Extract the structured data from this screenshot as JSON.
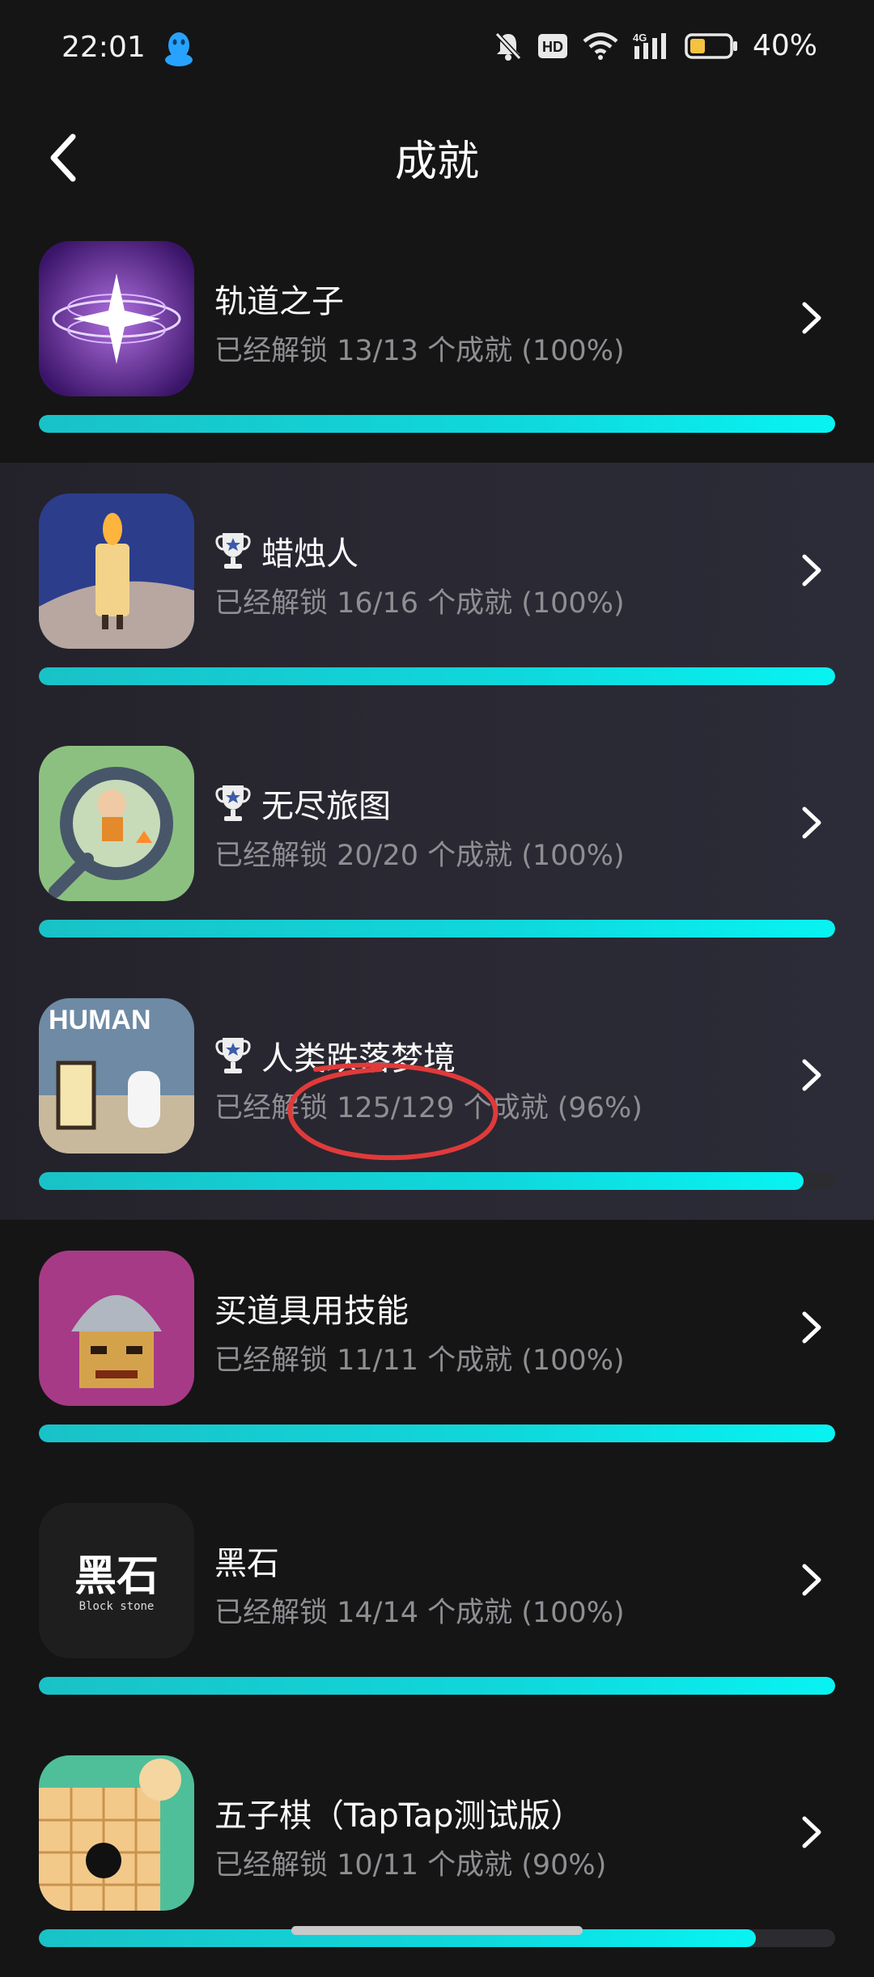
{
  "status_bar": {
    "time": "22:01",
    "battery_percent": "40%",
    "network_label": "4G",
    "hd_label": "HD",
    "battery_level": 0.4,
    "icons": [
      "qq-icon",
      "mute-bell-icon",
      "hd-icon",
      "wifi-icon",
      "signal-icon",
      "battery-icon"
    ]
  },
  "header": {
    "title": "成就",
    "back_icon": "back-chevron-icon"
  },
  "colors": {
    "background": "#151515",
    "highlight_row": "#2a2832",
    "progress_fill": "#0fd8dc",
    "progress_track": "#2c2c30",
    "secondary_text": "#8e8e93",
    "annotation": "#e03a3a"
  },
  "items": [
    {
      "title": "轨道之子",
      "progress": "已经解锁 13/13 个成就 (100%)",
      "fraction": 1.0,
      "trophy": false,
      "highlight": false,
      "icon": "orbit-game-icon"
    },
    {
      "title": "蜡烛人",
      "progress": "已经解锁 16/16 个成就 (100%)",
      "fraction": 1.0,
      "trophy": true,
      "highlight": true,
      "icon": "candleman-game-icon"
    },
    {
      "title": "无尽旅图",
      "progress": "已经解锁 20/20 个成就 (100%)",
      "fraction": 1.0,
      "trophy": true,
      "highlight": true,
      "icon": "endless-journey-game-icon"
    },
    {
      "title": "人类跌落梦境",
      "progress": "已经解锁 125/129 个成就 (96%)",
      "fraction": 0.96,
      "trophy": true,
      "highlight": true,
      "icon": "human-fall-flat-game-icon"
    },
    {
      "title": "买道具用技能",
      "progress": "已经解锁 11/11 个成就 (100%)",
      "fraction": 1.0,
      "trophy": false,
      "highlight": false,
      "icon": "knight-game-icon"
    },
    {
      "title": "黑石",
      "progress": "已经解锁 14/14 个成就 (100%)",
      "fraction": 1.0,
      "trophy": false,
      "highlight": false,
      "icon": "black-stone-game-icon",
      "icon_caption": "Block stone"
    },
    {
      "title": "五子棋（TapTap测试版）",
      "progress": "已经解锁 10/11 个成就 (90%)",
      "fraction": 0.9,
      "trophy": false,
      "highlight": false,
      "icon": "gomoku-game-icon"
    }
  ]
}
